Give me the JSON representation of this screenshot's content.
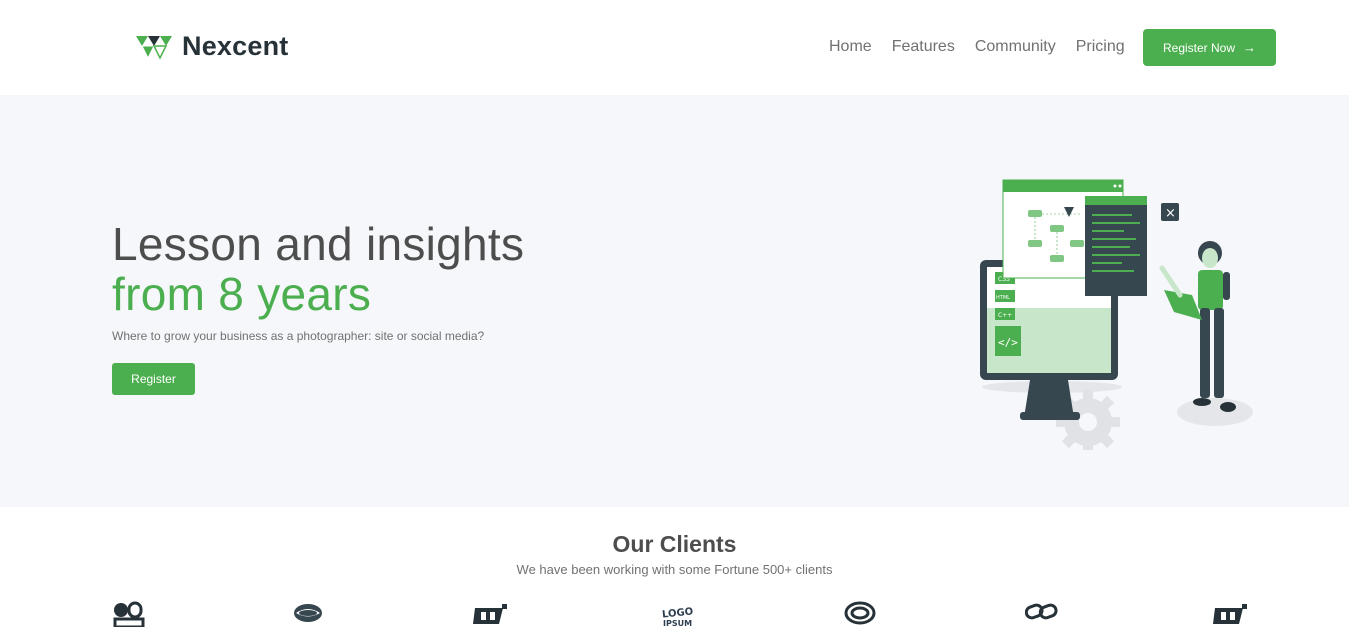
{
  "header": {
    "brand": "Nexcent",
    "nav": [
      "Home",
      "Features",
      "Community",
      "Pricing"
    ],
    "cta_label": "Register Now",
    "cta_arrow": "→"
  },
  "hero": {
    "title_line1": "Lesson and insights",
    "title_line2": "from 8 years",
    "subtitle": "Where to grow your business as a photographer: site or social media?",
    "button_label": "Register",
    "illustration_tags": [
      "CSS",
      "HTML",
      "C++"
    ]
  },
  "clients": {
    "title": "Our Clients",
    "subtitle": "We have been working with some Fortune 500+ clients",
    "logo_icons": [
      "client-logo-1-icon",
      "client-logo-2-icon",
      "client-logo-3-icon",
      "client-logo-4-icon",
      "client-logo-5-icon",
      "client-logo-6-icon",
      "client-logo-7-icon"
    ]
  },
  "colors": {
    "brand_green": "#4caf4f",
    "hero_bg": "#f5f7fa",
    "text_dark": "#263238",
    "text_grey": "#717171"
  }
}
